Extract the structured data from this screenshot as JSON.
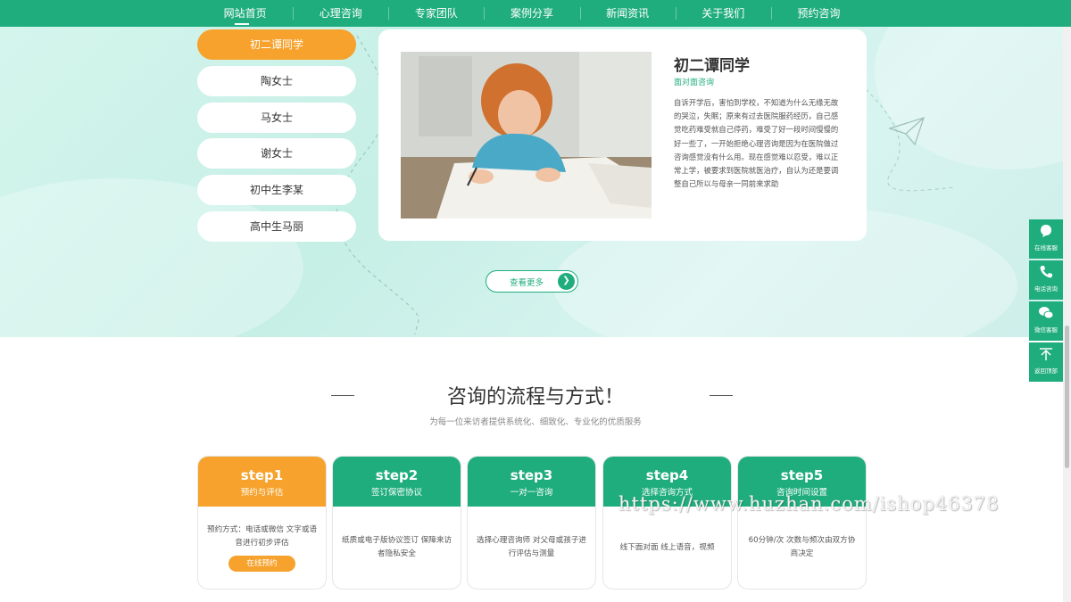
{
  "nav": {
    "items": [
      "网站首页",
      "心理咨询",
      "专家团队",
      "案例分享",
      "新闻资讯",
      "关于我们",
      "预约咨询"
    ],
    "active_index": 0
  },
  "cases": {
    "tabs": [
      "初二谭同学",
      "陶女士",
      "马女士",
      "谢女士",
      "初中生李某",
      "高中生马丽"
    ],
    "active_index": 0,
    "card": {
      "title": "初二谭同学",
      "subtitle": "面对面咨询",
      "text": "自诉开学后，害怕到学校，不知道为什么无缘无故的哭泣，失眠；原来有过去医院服药经历，自己感觉吃药难受就自己停药，难受了好一段时间慢慢的好一些了，一开始拒绝心理咨询是因为在医院做过咨询感觉没有什么用。现在感觉难以忍受，难以正常上学，被要求到医院就医治疗，自认为还是要调整自己所以与母亲一同前来求助",
      "image_icon": "child-drawing-photo"
    },
    "more_label": "查看更多"
  },
  "process": {
    "title": "咨询的流程与方式！",
    "subtitle": "为每一位来访者提供系统化、细致化、专业化的优质服务",
    "steps": [
      {
        "num": "step1",
        "name": "预约与评估",
        "desc": "预约方式：电话或微信 文字或语音进行初步评估",
        "button": "在线预约"
      },
      {
        "num": "step2",
        "name": "签订保密协议",
        "desc": "纸质或电子版协议签订 保障来访者隐私安全"
      },
      {
        "num": "step3",
        "name": "一对一咨询",
        "desc": "选择心理咨询师 对父母或孩子进行评估与测量"
      },
      {
        "num": "step4",
        "name": "选择咨询方式",
        "desc": "线下面对面 线上语音，视频"
      },
      {
        "num": "step5",
        "name": "咨询时间设置",
        "desc": "60分钟/次 次数与频次由双方协商决定"
      }
    ]
  },
  "sidebar": {
    "items": [
      {
        "label": "在线客服",
        "icon": "chat-bubble-icon"
      },
      {
        "label": "电话咨询",
        "icon": "phone-icon"
      },
      {
        "label": "微信客服",
        "icon": "wechat-icon"
      },
      {
        "label": "返回顶部",
        "icon": "back-to-top-icon"
      }
    ]
  },
  "watermark": "https://www.huzhan.com/ishop46378",
  "colors": {
    "primary": "#20ad7e",
    "accent": "#f6a22c",
    "hero_bg": "#d4f5ec"
  }
}
